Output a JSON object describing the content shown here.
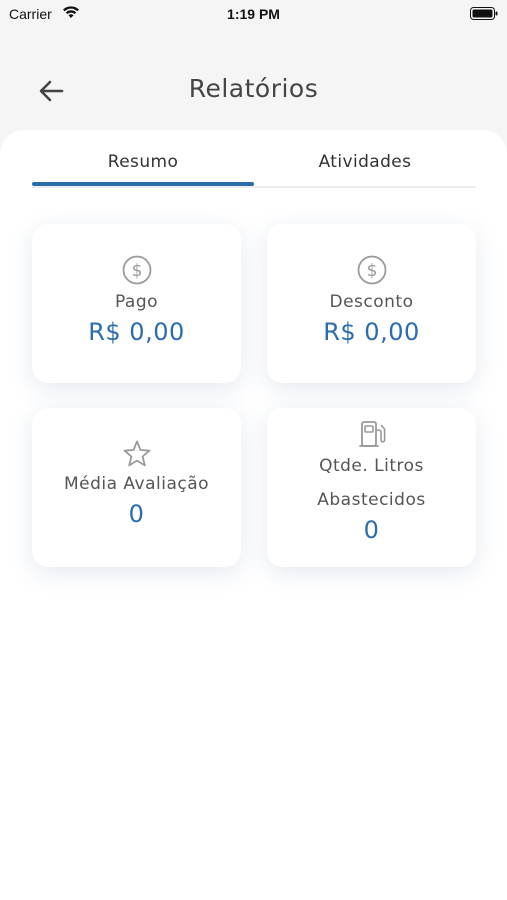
{
  "status_bar": {
    "carrier": "Carrier",
    "time": "1:19 PM"
  },
  "header": {
    "title": "Relatórios",
    "back_icon": "arrow-left-icon"
  },
  "tabs": [
    {
      "label": "Resumo",
      "active": true
    },
    {
      "label": "Atividades",
      "active": false
    }
  ],
  "cards": {
    "pago": {
      "icon": "dollar-circle-icon",
      "label": "Pago",
      "value": "R$ 0,00"
    },
    "desconto": {
      "icon": "dollar-circle-icon",
      "label": "Desconto",
      "value": "R$ 0,00"
    },
    "media": {
      "icon": "star-icon",
      "label": "Média Avaliação",
      "value": "0"
    },
    "litros": {
      "icon": "fuel-pump-icon",
      "label_line1": "Qtde. Litros",
      "label_line2": "Abastecidos",
      "value": "0"
    }
  },
  "colors": {
    "accent": "#2a6cad",
    "background": "#f5f5f6",
    "card": "#ffffff"
  }
}
